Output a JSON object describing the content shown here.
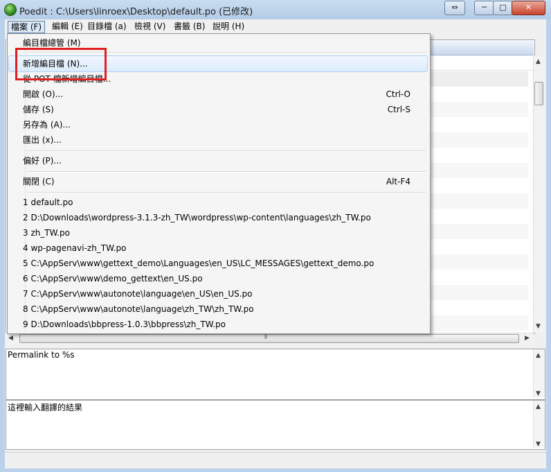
{
  "window": {
    "title": "Poedit : C:\\Users\\linroex\\Desktop\\default.po (已修改)",
    "controls": {
      "minimize": "─",
      "maximize": "□",
      "close": "✕",
      "swap": "⇔"
    }
  },
  "menubar": [
    {
      "id": "file",
      "label": "檔案 (F)"
    },
    {
      "id": "edit",
      "label": "編輯 (E)"
    },
    {
      "id": "catalog",
      "label": "目錄檔 (a)"
    },
    {
      "id": "view",
      "label": "檢視 (V)"
    },
    {
      "id": "bookmarks",
      "label": "書籤 (B)"
    },
    {
      "id": "help",
      "label": "說明 (H)"
    }
  ],
  "file_menu": {
    "items": [
      {
        "label": "編目檔總管 (M)",
        "shortcut": ""
      },
      {
        "label": "新增編目檔 (N)...",
        "shortcut": ""
      },
      {
        "label": "從 POT 檔新增編目檔...",
        "shortcut": ""
      },
      {
        "label": "開啟 (O)...",
        "shortcut": "Ctrl-O"
      },
      {
        "label": "儲存 (S)",
        "shortcut": "Ctrl-S"
      },
      {
        "label": "另存為 (A)...",
        "shortcut": ""
      },
      {
        "label": "匯出 (x)...",
        "shortcut": ""
      },
      {
        "label": "偏好 (P)...",
        "shortcut": ""
      },
      {
        "label": "關閉 (C)",
        "shortcut": "Alt-F4"
      }
    ],
    "recent_files": [
      "1 default.po",
      "2 D:\\Downloads\\wordpress-3.1.3-zh_TW\\wordpress\\wp-content\\languages\\zh_TW.po",
      "3 zh_TW.po",
      "4 wp-pagenavi-zh_TW.po",
      "5 C:\\AppServ\\www\\gettext_demo\\Languages\\en_US\\LC_MESSAGES\\gettext_demo.po",
      "6 C:\\AppServ\\www\\demo_gettext\\en_US.po",
      "7 C:\\AppServ\\www\\autonote\\language\\en_US\\en_US.po",
      "8 C:\\AppServ\\www\\autonote\\language\\zh_TW\\zh_TW.po",
      "9 D:\\Downloads\\bbpress-1.0.3\\bbpress\\zh_TW.po"
    ]
  },
  "source_pane": {
    "text": "Permalink to %s"
  },
  "translation_pane": {
    "text": "這裡輸入翻譯的結果"
  },
  "colors": {
    "highlight_box": "#e02020",
    "frame": "#b9d1ea",
    "hover": "#dcebfc"
  }
}
